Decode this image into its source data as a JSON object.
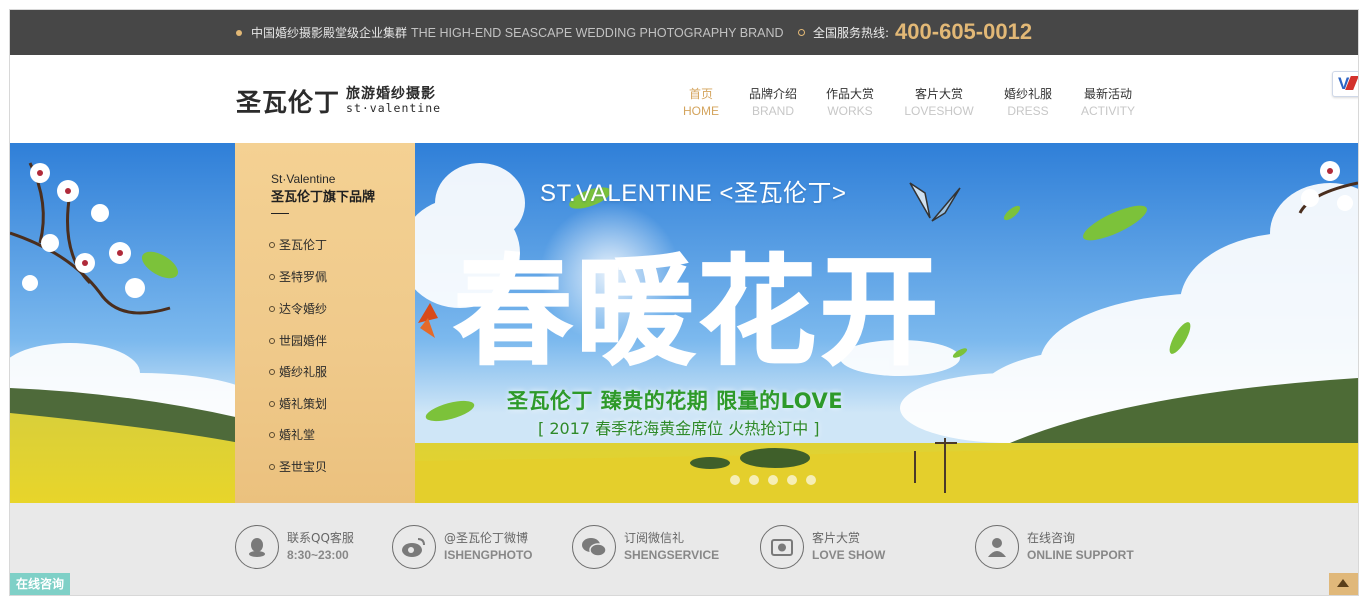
{
  "topbar": {
    "slogan_cn": "中国婚纱摄影殿堂级企业集群",
    "slogan_en": "THE HIGH-END SEASCAPE WEDDING PHOTOGRAPHY BRAND",
    "hotline_label": "全国服务热线:",
    "phone": "400-605-0012"
  },
  "logo": {
    "name_cn": "圣瓦伦丁",
    "tagline": "旅游婚纱摄影",
    "name_en": "st·valentine"
  },
  "nav": {
    "items": [
      {
        "cn": "首页",
        "en": "HOME",
        "active": true
      },
      {
        "cn": "品牌介绍",
        "en": "BRAND",
        "active": false
      },
      {
        "cn": "作品大赏",
        "en": "WORKS",
        "active": false
      },
      {
        "cn": "客片大赏",
        "en": "LOVESHOW",
        "active": false
      },
      {
        "cn": "婚纱礼服",
        "en": "DRESS",
        "active": false
      },
      {
        "cn": "最新活动",
        "en": "ACTIVITY",
        "active": false
      }
    ]
  },
  "dropdown": {
    "title_en": "St·Valentine",
    "title_cn": "圣瓦伦丁旗下品牌",
    "items": [
      "圣瓦伦丁",
      "圣特罗佩",
      "达令婚纱",
      "世园婚伴",
      "婚纱礼服",
      "婚礼策划",
      "婚礼堂",
      "圣世宝贝"
    ]
  },
  "banner": {
    "subtitle_en": "ST.VALENTINE <圣瓦伦丁>",
    "headline": "春暖花开",
    "caption": "圣瓦伦丁 臻贵的花期 限量的LOVE",
    "caption2": "[ 2017 春季花海黄金席位 火热抢订中 ]",
    "slide_count": 5
  },
  "services": [
    {
      "icon": "qq-icon",
      "line1": "联系QQ客服",
      "line2": "8:30~23:00"
    },
    {
      "icon": "weibo-icon",
      "line1": "@圣瓦伦丁微博",
      "line2": "ISHENGPHOTO"
    },
    {
      "icon": "wechat-icon",
      "line1": "订阅微信礼",
      "line2": "SHENGSERVICE"
    },
    {
      "icon": "photo-icon",
      "line1": "客片大赏",
      "line2": "LOVE SHOW"
    },
    {
      "icon": "user-icon",
      "line1": "在线咨询",
      "line2": "ONLINE SUPPORT"
    }
  ],
  "online_tag": "在线咨询",
  "colors": {
    "topbar_bg": "#474747",
    "accent_gold": "#e2b876",
    "nav_active": "#d4a45d",
    "dropdown_bg": "#f0cb8a",
    "strip_bg": "#e9e9e9",
    "caption_green": "#2e9a2a"
  }
}
